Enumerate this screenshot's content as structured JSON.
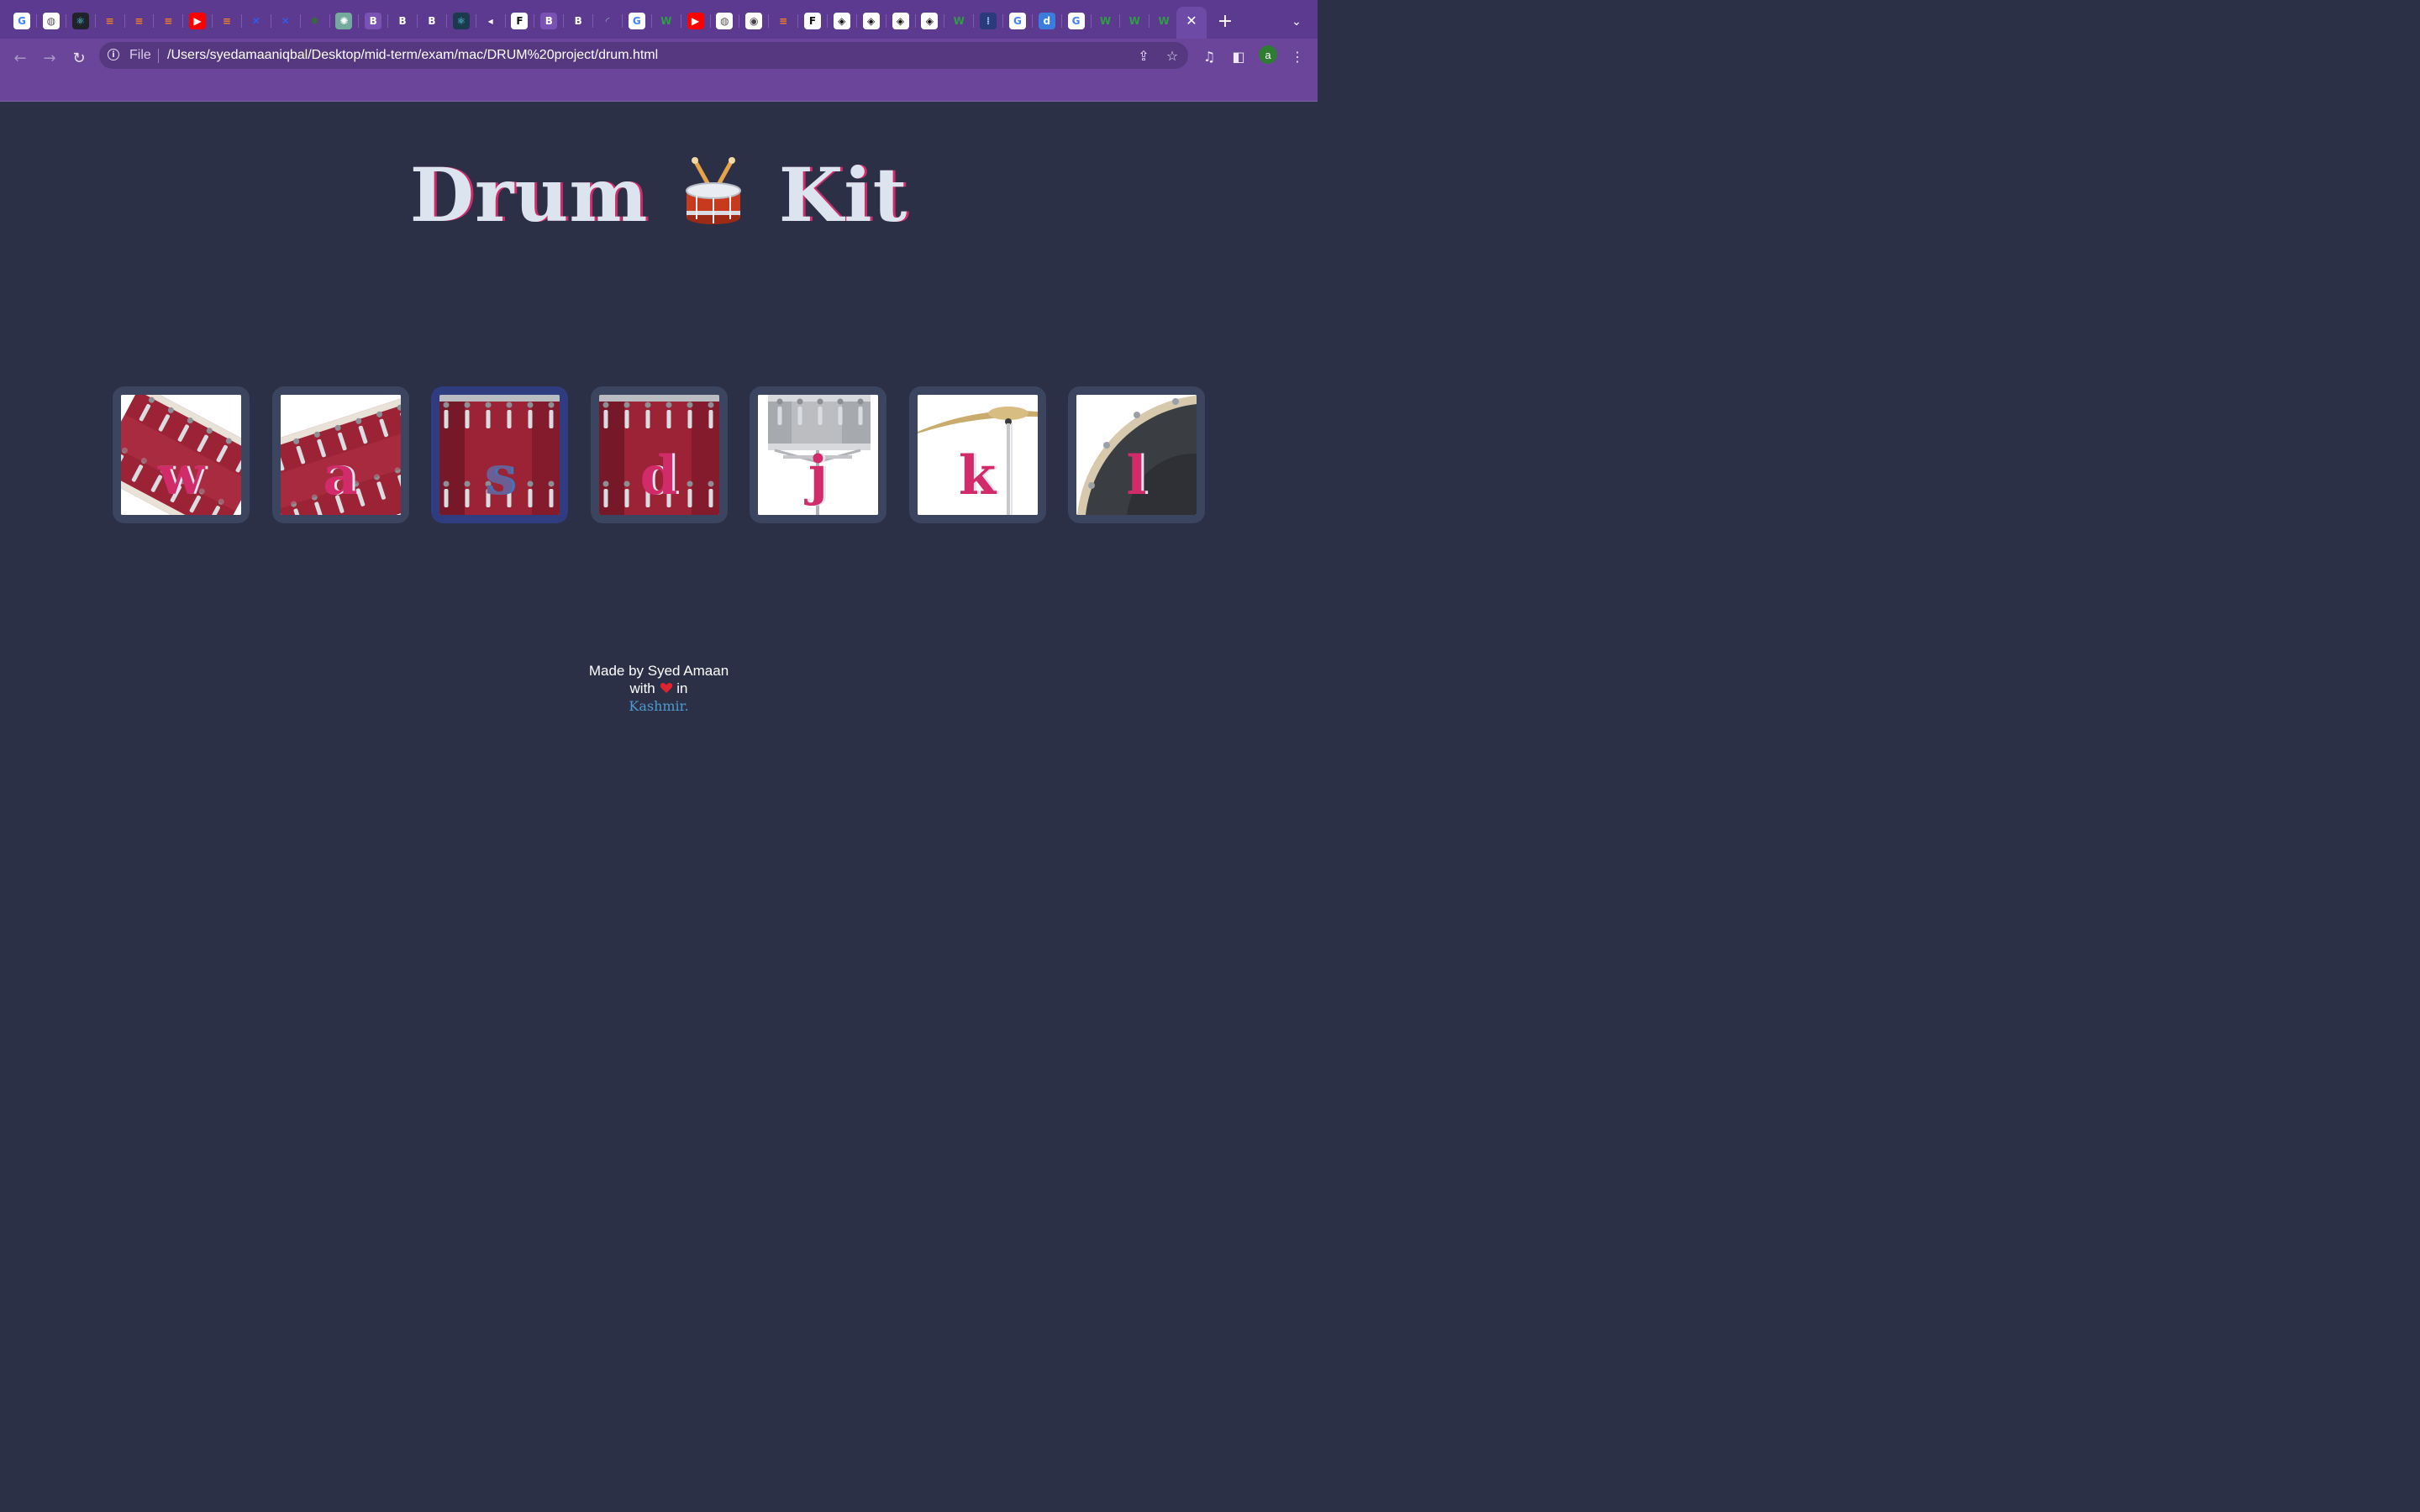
{
  "browser": {
    "tab_favicons": [
      "google",
      "globe",
      "react",
      "stackoverflow",
      "stackoverflow",
      "stackoverflow",
      "youtube",
      "stackoverflow",
      "hashnode",
      "hashnode",
      "leaf",
      "chatgpt",
      "bootstrap",
      "b-letter",
      "b-letter",
      "react-alt",
      "speaker",
      "f-letter",
      "bootstrap",
      "b-letter",
      "spinner",
      "google",
      "w-letter",
      "youtube",
      "globe",
      "chrome",
      "stackoverflow",
      "f-letter",
      "codepen",
      "codepen",
      "codepen",
      "codepen",
      "w-letter",
      "dots",
      "google",
      "d-letter",
      "google",
      "w-letter",
      "w-letter",
      "w-letter"
    ],
    "active_tab_close": "✕",
    "new_tab": "+",
    "tab_menu": "⌄",
    "scheme_label": "File",
    "url": "/Users/syedamaaniqbal/Desktop/mid-term/exam/mac/DRUM%20project/drum.html",
    "profile_initial": "a",
    "colors": {
      "tabstrip": "#5b3a8f",
      "toolbar": "#6a459a",
      "omnibox": "#553880"
    }
  },
  "page": {
    "title_left": "Drum",
    "title_right": "Kit",
    "title_emoji": "drum-emoji",
    "background": "#2b3046",
    "accent": "#d12b6a",
    "drums": [
      {
        "key": "w",
        "image": "tom-drum-tilted",
        "pressed": false
      },
      {
        "key": "a",
        "image": "tom-drum-tilted-alt",
        "pressed": false
      },
      {
        "key": "s",
        "image": "snare-drum-red",
        "pressed": true
      },
      {
        "key": "d",
        "image": "floor-tom-red",
        "pressed": false
      },
      {
        "key": "j",
        "image": "snare-chrome-stand",
        "pressed": false
      },
      {
        "key": "k",
        "image": "crash-cymbal",
        "pressed": false
      },
      {
        "key": "l",
        "image": "bass-drum-black",
        "pressed": false
      }
    ],
    "footer": {
      "line1": "Made by Syed Amaan",
      "line2_prefix": "with",
      "line2_suffix": "in",
      "location": "Kashmir."
    }
  }
}
